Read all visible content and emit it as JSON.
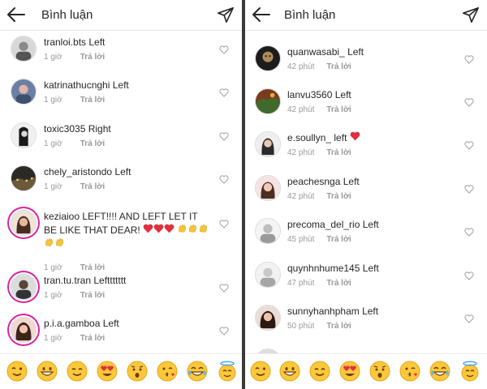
{
  "header": {
    "title": "Bình luận",
    "back_icon": "arrow-left-icon",
    "send_icon": "paper-plane-icon"
  },
  "colors": {
    "heart_red": "#e0303f",
    "story_ring": "#d6249f",
    "meta_gray": "#999999"
  },
  "left_comments": [
    {
      "username": "tranloi.bts",
      "text": "Left",
      "time": "1 giờ",
      "reply": "Trả lời"
    },
    {
      "username": "katrinathucnghi",
      "text": "Left",
      "time": "1 giờ",
      "reply": "Trả lời"
    },
    {
      "username": "toxic3035",
      "text": "Right",
      "time": "1 giờ",
      "reply": "Trả lời"
    },
    {
      "username": "chely_aristondo",
      "text": "Left",
      "time": "1 giờ",
      "reply": "Trả lời"
    },
    {
      "username": "keziaioo",
      "text": "LEFT!!!! AND LEFT LET IT BE LIKE THAT DEAR!",
      "time": "1 giờ",
      "reply": "Trả lời"
    },
    {
      "username": "tran.tu.tran",
      "text": "Lefttttttt",
      "time": "1 giờ",
      "reply": "Trả lời"
    },
    {
      "username": "p.i.a.gamboa",
      "text": "Left",
      "time": "1 giờ",
      "reply": "Trả lời"
    }
  ],
  "right_comments": [
    {
      "username": "quanwasabi_",
      "text": "Left",
      "time": "42 phút",
      "reply": "Trả lời"
    },
    {
      "username": "lanvu3560",
      "text": "Left",
      "time": "42 phút",
      "reply": "Trả lời"
    },
    {
      "username": "e.soullyn_",
      "text": "left",
      "time": "42 phút",
      "reply": "Trả lời"
    },
    {
      "username": "peachesnga",
      "text": "Left",
      "time": "42 phút",
      "reply": "Trả lời"
    },
    {
      "username": "precoma_del_rio",
      "text": "Left",
      "time": "45 phút",
      "reply": "Trả lời"
    },
    {
      "username": "quynhnhume145",
      "text": "Left",
      "time": "47 phút",
      "reply": "Trả lời"
    },
    {
      "username": "sunnyhanhpham",
      "text": "Left",
      "time": "50 phút",
      "reply": "Trả lời"
    }
  ],
  "emoji_bar": [
    "winking-face",
    "grinning-face",
    "smiling-face",
    "heart-eyes-face",
    "hushed-face",
    "kissing-wink-face",
    "tears-of-joy-face",
    "halo-face"
  ]
}
